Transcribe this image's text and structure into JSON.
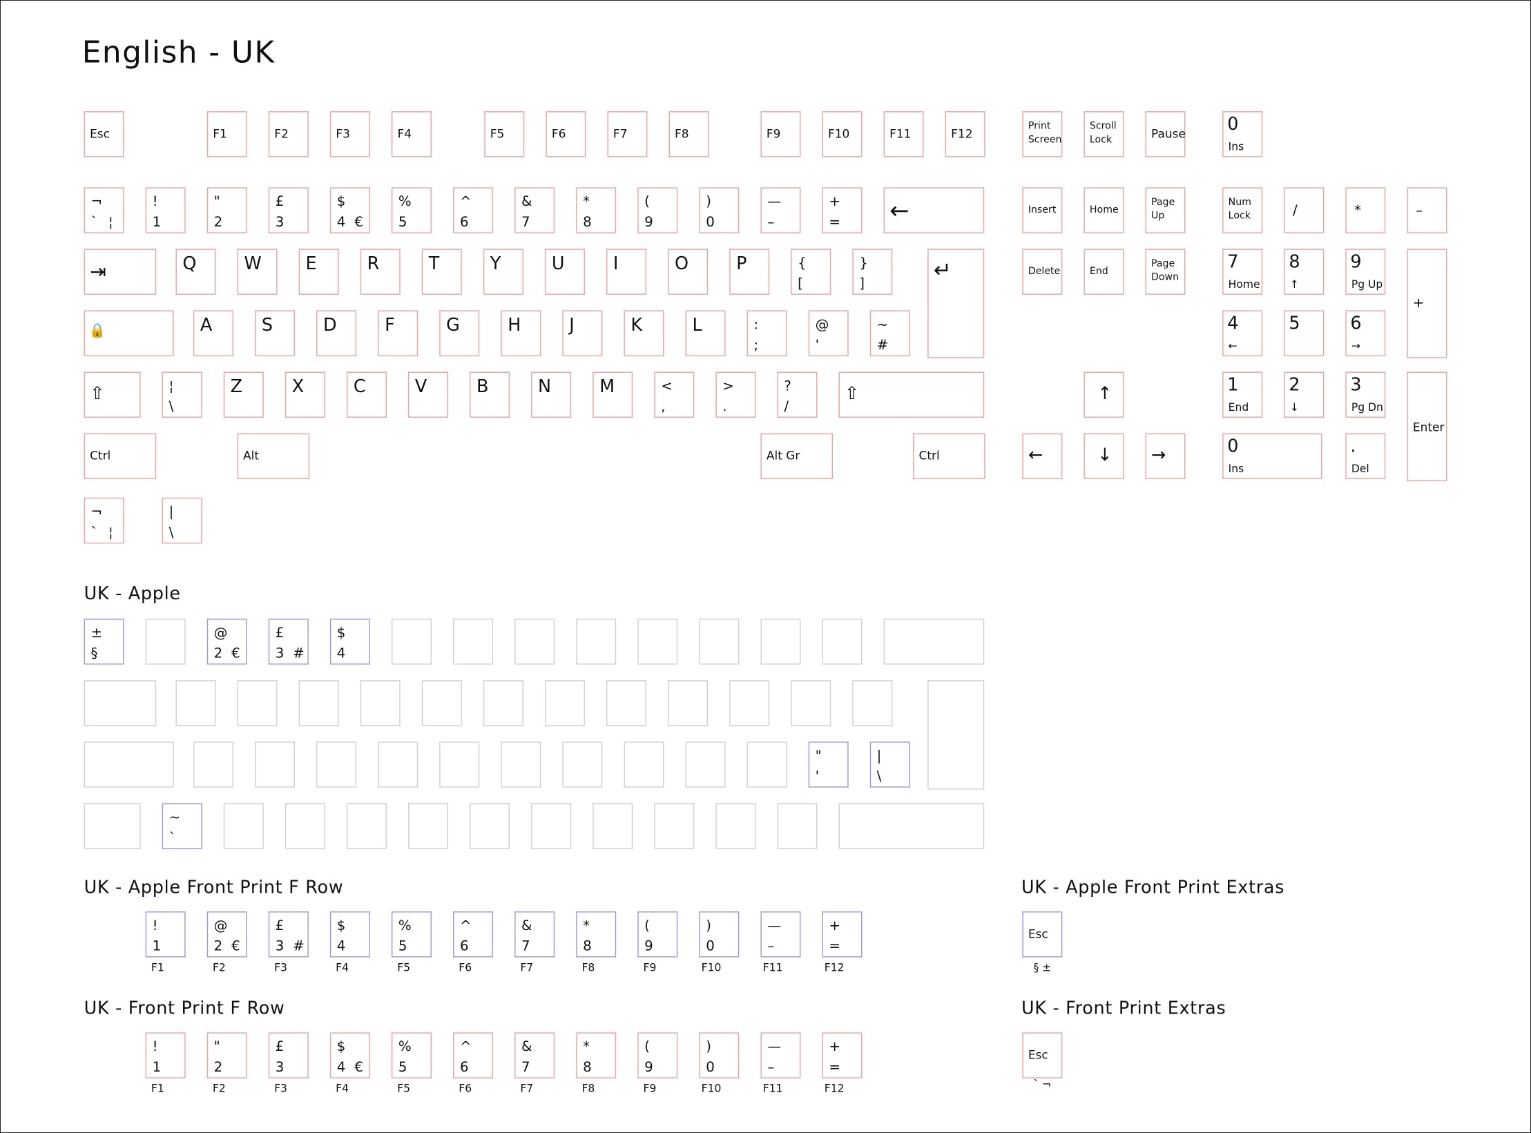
{
  "title": "English - UK",
  "colors": {
    "uk_key_border": "#f2a0a0",
    "apple_key_border": "#9a96e6",
    "blank_key_border": "#cfcfcf"
  },
  "sections": {
    "apple": "UK - Apple",
    "apple_front_f": "UK - Apple Front Print F Row",
    "apple_front_extras": "UK - Apple Front Print Extras",
    "front_f": "UK - Front Print F Row",
    "front_extras": "UK - Front Print Extras"
  },
  "icons": {
    "backspace": "left-arrow-icon",
    "tab": "tab-arrow-icon",
    "enter": "return-arrow-icon",
    "caps_lock": "caps-lock-icon",
    "shift": "shift-icon",
    "arrow_up": "arrow-up-icon",
    "arrow_down": "arrow-down-icon",
    "arrow_left": "arrow-left-icon",
    "arrow_right": "arrow-right-icon"
  },
  "keys": {
    "esc": "Esc",
    "f": [
      "F1",
      "F2",
      "F3",
      "F4",
      "F5",
      "F6",
      "F7",
      "F8",
      "F9",
      "F10",
      "F11",
      "F12"
    ],
    "print_screen": [
      "Print",
      "Screen"
    ],
    "scroll_lock": [
      "Scroll",
      "Lock"
    ],
    "pause": "Pause",
    "extra_zero": {
      "main": "0",
      "sub": "Ins"
    },
    "num_row": [
      {
        "top": "¬",
        "bottom": "`",
        "alt": "¦"
      },
      {
        "top": "!",
        "bottom": "1"
      },
      {
        "top": "\"",
        "bottom": "2"
      },
      {
        "top": "£",
        "bottom": "3"
      },
      {
        "top": "$",
        "bottom": "4",
        "alt": "€"
      },
      {
        "top": "%",
        "bottom": "5"
      },
      {
        "top": "^",
        "bottom": "6"
      },
      {
        "top": "&",
        "bottom": "7"
      },
      {
        "top": "*",
        "bottom": "8"
      },
      {
        "top": "(",
        "bottom": "9"
      },
      {
        "top": ")",
        "bottom": "0"
      },
      {
        "top": "—",
        "bottom": "–"
      },
      {
        "top": "+",
        "bottom": "="
      }
    ],
    "row_q": [
      "Q",
      "W",
      "E",
      "R",
      "T",
      "Y",
      "U",
      "I",
      "O",
      "P"
    ],
    "brackets": [
      {
        "top": "{",
        "bottom": "["
      },
      {
        "top": "}",
        "bottom": "]"
      }
    ],
    "row_a": [
      "A",
      "S",
      "D",
      "F",
      "G",
      "H",
      "J",
      "K",
      "L"
    ],
    "row_a_punct": [
      {
        "top": ":",
        "bottom": ";"
      },
      {
        "top": "@",
        "bottom": "'"
      },
      {
        "top": "~",
        "bottom": "#"
      }
    ],
    "iso_key": {
      "top": "¦",
      "bottom": "\\"
    },
    "row_z": [
      "Z",
      "X",
      "C",
      "V",
      "B",
      "N",
      "M"
    ],
    "row_z_punct": [
      {
        "top": "<",
        "bottom": ","
      },
      {
        "top": ">",
        "bottom": "."
      },
      {
        "top": "?",
        "bottom": "/"
      }
    ],
    "ctrl": "Ctrl",
    "alt": "Alt",
    "alt_gr": "Alt Gr",
    "extra_row": [
      {
        "top": "¬",
        "bottom": "`",
        "alt": "¦"
      },
      {
        "top": "|",
        "bottom": "\\"
      }
    ],
    "nav": {
      "insert": "Insert",
      "home": "Home",
      "page_up": [
        "Page",
        "Up"
      ],
      "delete": "Delete",
      "end": "End",
      "page_down": [
        "Page",
        "Down"
      ]
    },
    "numpad": {
      "num_lock": [
        "Num",
        "Lock"
      ],
      "slash": "/",
      "star": "*",
      "minus": "–",
      "plus": "+",
      "enter": "Enter",
      "n7": {
        "main": "7",
        "sub": "Home"
      },
      "n8": {
        "main": "8",
        "sub": "↑"
      },
      "n9": {
        "main": "9",
        "sub": "Pg Up"
      },
      "n4": {
        "main": "4",
        "sub": "←"
      },
      "n5": {
        "main": "5"
      },
      "n6": {
        "main": "6",
        "sub": "→"
      },
      "n1": {
        "main": "1",
        "sub": "End"
      },
      "n2": {
        "main": "2",
        "sub": "↓"
      },
      "n3": {
        "main": "3",
        "sub": "Pg Dn"
      },
      "n0": {
        "main": "0",
        "sub": "Ins"
      },
      "dot": {
        "main": ".",
        "sub": "Del"
      }
    }
  },
  "apple": {
    "num_keys": [
      {
        "top": "±",
        "bottom": "§"
      },
      {
        "top": "@",
        "bottom": "2",
        "alt": "€"
      },
      {
        "top": "£",
        "bottom": "3",
        "alt": "#"
      },
      {
        "top": "$",
        "bottom": "4"
      }
    ],
    "quote_key": {
      "top": "\"",
      "bottom": "'"
    },
    "pipe_key": {
      "top": "|",
      "bottom": "\\"
    },
    "tilde_key": {
      "top": "~",
      "bottom": "`"
    }
  },
  "apple_front_row": [
    {
      "top": "!",
      "bottom": "1",
      "f": "F1"
    },
    {
      "top": "@",
      "bottom": "2",
      "alt": "€",
      "f": "F2"
    },
    {
      "top": "£",
      "bottom": "3",
      "alt": "#",
      "f": "F3"
    },
    {
      "top": "$",
      "bottom": "4",
      "f": "F4"
    },
    {
      "top": "%",
      "bottom": "5",
      "f": "F5"
    },
    {
      "top": "^",
      "bottom": "6",
      "f": "F6"
    },
    {
      "top": "&",
      "bottom": "7",
      "f": "F7"
    },
    {
      "top": "*",
      "bottom": "8",
      "f": "F8"
    },
    {
      "top": "(",
      "bottom": "9",
      "f": "F9"
    },
    {
      "top": ")",
      "bottom": "0",
      "f": "F10"
    },
    {
      "top": "—",
      "bottom": "–",
      "f": "F11"
    },
    {
      "top": "+",
      "bottom": "=",
      "f": "F12"
    }
  ],
  "apple_front_extras": {
    "key": "Esc",
    "caption": "§ ±"
  },
  "front_row": [
    {
      "top": "!",
      "bottom": "1",
      "f": "F1"
    },
    {
      "top": "\"",
      "bottom": "2",
      "f": "F2"
    },
    {
      "top": "£",
      "bottom": "3",
      "f": "F3"
    },
    {
      "top": "$",
      "bottom": "4",
      "alt": "€",
      "f": "F4"
    },
    {
      "top": "%",
      "bottom": "5",
      "f": "F5"
    },
    {
      "top": "^",
      "bottom": "6",
      "f": "F6"
    },
    {
      "top": "&",
      "bottom": "7",
      "f": "F7"
    },
    {
      "top": "*",
      "bottom": "8",
      "f": "F8"
    },
    {
      "top": "(",
      "bottom": "9",
      "f": "F9"
    },
    {
      "top": ")",
      "bottom": "0",
      "f": "F10"
    },
    {
      "top": "—",
      "bottom": "–",
      "f": "F11"
    },
    {
      "top": "+",
      "bottom": "=",
      "f": "F12"
    }
  ],
  "front_extras": {
    "key": "Esc",
    "caption": "` ¬"
  }
}
